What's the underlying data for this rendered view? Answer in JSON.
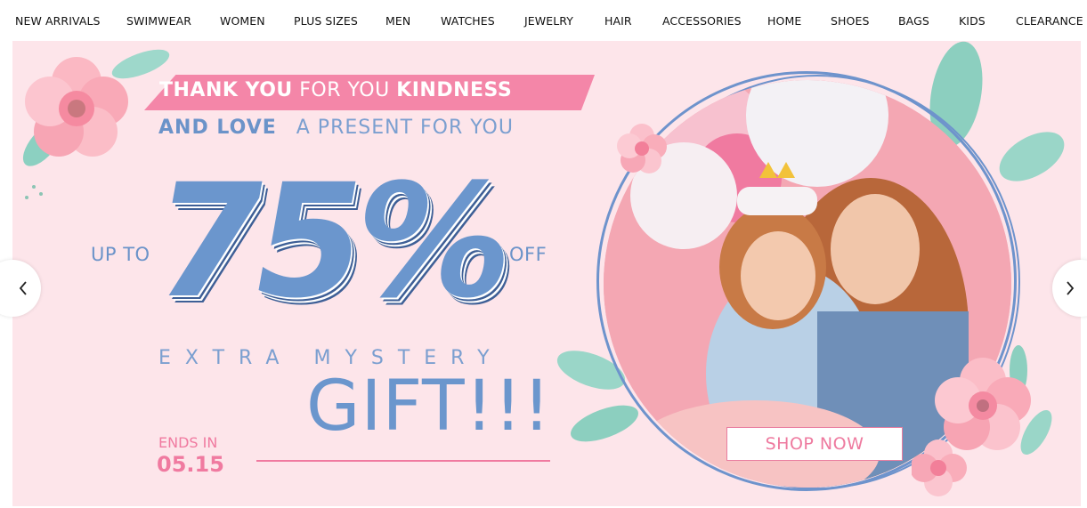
{
  "nav": {
    "items": [
      {
        "label": "NEW ARRIVALS"
      },
      {
        "label": "SWIMWEAR"
      },
      {
        "label": "WOMEN"
      },
      {
        "label": "PLUS SIZES"
      },
      {
        "label": "MEN"
      },
      {
        "label": "WATCHES"
      },
      {
        "label": "JEWELRY"
      },
      {
        "label": "HAIR"
      },
      {
        "label": "ACCESSORIES"
      },
      {
        "label": "HOME"
      },
      {
        "label": "SHOES"
      },
      {
        "label": "BAGS"
      },
      {
        "label": "KIDS"
      },
      {
        "label": "CLEARANCE"
      }
    ]
  },
  "banner": {
    "ribbon_bold1": "THANK YOU",
    "ribbon_light": "FOR YOU",
    "ribbon_bold2": "KINDNESS",
    "line2_bold": "AND LOVE",
    "line2_light": "A  PRESENT FOR YOU",
    "up_to": "UP TO",
    "percent": "75%",
    "off": "OFF",
    "extra": "EXTRA MYSTERY",
    "gift": "GIFT!!!",
    "ends_label": "ENDS IN",
    "ends_date": "05.15",
    "shop_now": "SHOP NOW"
  },
  "carousel": {
    "slide_count": 3,
    "active_index": 2
  },
  "colors": {
    "banner_bg": "#fde5ea",
    "accent_pink": "#f486a8",
    "accent_blue": "#6b96cd"
  },
  "icons": {
    "prev": "chevron-left-icon",
    "next": "chevron-right-icon"
  }
}
